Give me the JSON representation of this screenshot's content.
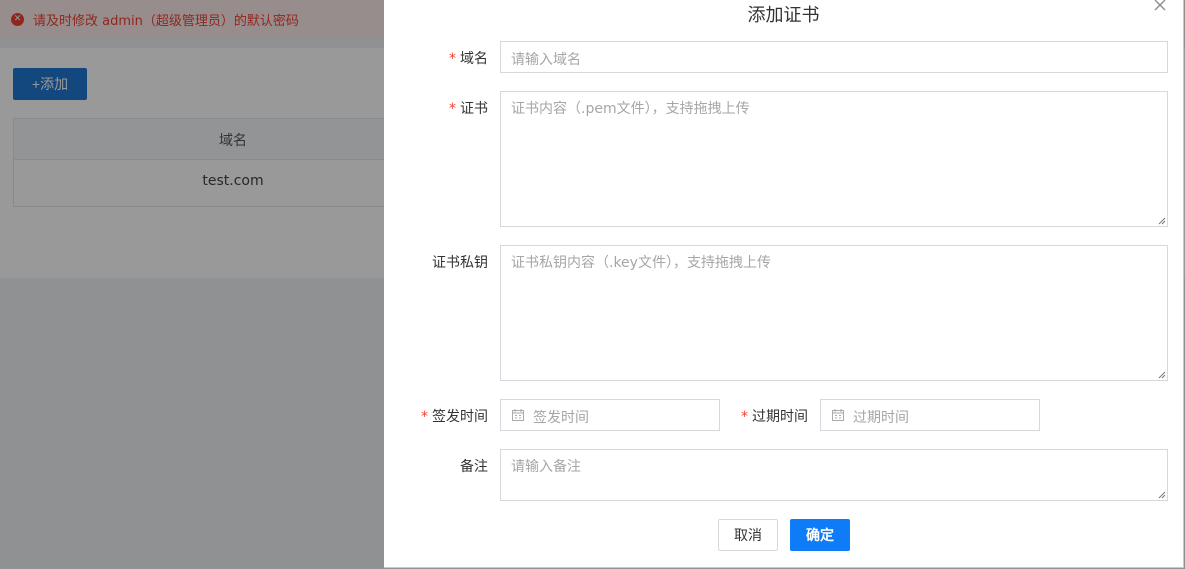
{
  "background": {
    "alert_text": "请及时修改 admin（超级管理员）的默认密码",
    "add_button_label": "+添加",
    "table": {
      "columns": [
        "域名"
      ],
      "rows": [
        [
          "test.com"
        ]
      ]
    }
  },
  "dialog": {
    "title": "添加证书",
    "fields": {
      "domain": {
        "label": "域名",
        "required": true,
        "placeholder": "请输入域名"
      },
      "certificate": {
        "label": "证书",
        "required": true,
        "placeholder": "证书内容（.pem文件），支持拖拽上传"
      },
      "private_key": {
        "label": "证书私钥",
        "required": false,
        "placeholder": "证书私钥内容（.key文件），支持拖拽上传"
      },
      "issue_time": {
        "label": "签发时间",
        "required": true,
        "placeholder": "签发时间"
      },
      "expire_time": {
        "label": "过期时间",
        "required": true,
        "placeholder": "过期时间"
      },
      "remark": {
        "label": "备注",
        "required": false,
        "placeholder": "请输入备注"
      }
    },
    "cancel_label": "取消",
    "confirm_label": "确定"
  },
  "colors": {
    "primary": "#0f7cf7",
    "danger": "#f04134",
    "alert_bg": "#fdecec"
  }
}
